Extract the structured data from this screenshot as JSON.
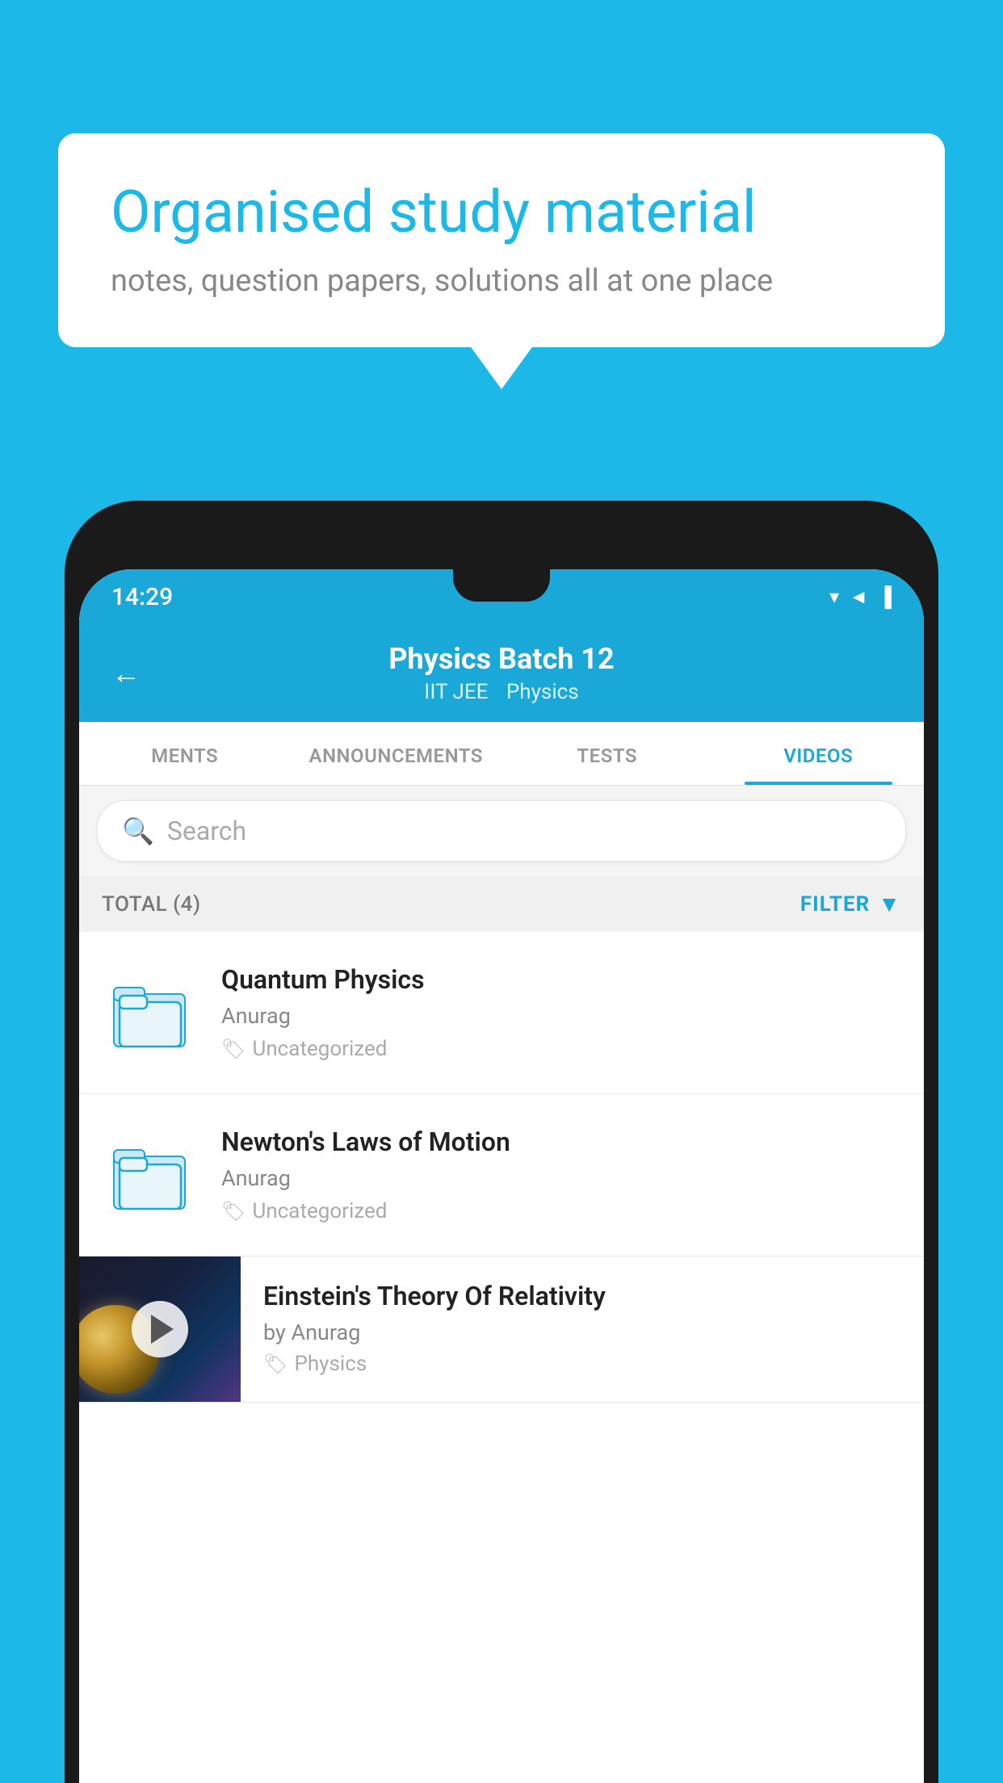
{
  "background": {
    "color": "#1bb8e8"
  },
  "speech_bubble": {
    "title": "Organised study material",
    "subtitle": "notes, question papers, solutions all at one place"
  },
  "phone": {
    "status_bar": {
      "time": "14:29",
      "icons": "▼◄▐"
    },
    "header": {
      "title": "Physics Batch 12",
      "subtitle1": "IIT JEE",
      "subtitle2": "Physics",
      "back_label": "←"
    },
    "tabs": [
      {
        "label": "MENTS",
        "active": false
      },
      {
        "label": "ANNOUNCEMENTS",
        "active": false
      },
      {
        "label": "TESTS",
        "active": false
      },
      {
        "label": "VIDEOS",
        "active": true
      }
    ],
    "search": {
      "placeholder": "Search"
    },
    "filter_bar": {
      "total": "TOTAL (4)",
      "filter_label": "FILTER"
    },
    "video_items": [
      {
        "title": "Quantum Physics",
        "author": "Anurag",
        "tag": "Uncategorized",
        "type": "folder"
      },
      {
        "title": "Newton's Laws of Motion",
        "author": "Anurag",
        "tag": "Uncategorized",
        "type": "folder"
      },
      {
        "title": "Einstein's Theory Of Relativity",
        "author": "by Anurag",
        "tag": "Physics",
        "type": "video"
      }
    ]
  }
}
